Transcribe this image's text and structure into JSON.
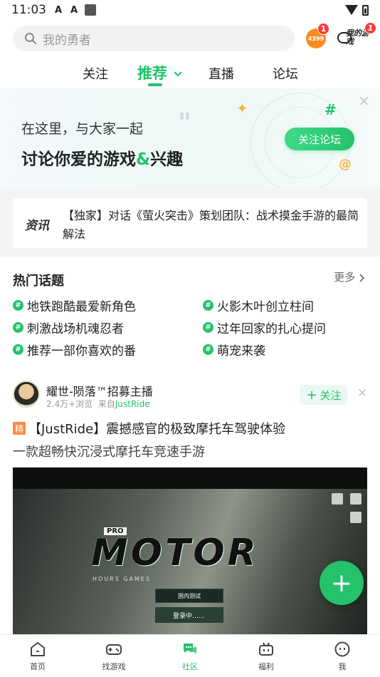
{
  "status": {
    "time": "11:03"
  },
  "search": {
    "placeholder": "我的勇者",
    "app_badge": "1",
    "my_games_badge": "1",
    "app_icon_text": "4399",
    "my_games_label": "我的游戏"
  },
  "tabs": [
    {
      "label": "关注"
    },
    {
      "label": "推荐",
      "active": true
    },
    {
      "label": "直播"
    },
    {
      "label": "论坛"
    }
  ],
  "banner": {
    "line1": "在这里，与大家一起",
    "line2_a": "讨论你爱的游戏",
    "line2_amp": "&",
    "line2_b": "兴趣",
    "button": "关注论坛"
  },
  "news": {
    "tag": "资讯",
    "text": "【独家】对话《萤火突击》策划团队：战术摸金手游的最简解法"
  },
  "hot_topics": {
    "title": "热门话题",
    "more": "更多",
    "items": [
      "地铁跑酷最爱新角色",
      "火影木叶创立柱间",
      "刺激战场机魂忍者",
      "过年回家的扎心提问",
      "推荐一部你喜欢的番",
      "萌宠来袭"
    ]
  },
  "post": {
    "user": "耀世-陨落™招募主播",
    "views": "2.4万+浏览",
    "source_prefix": "来自",
    "source": "JustRide",
    "follow": "关注",
    "tag": "精",
    "title": "【JustRide】震撼感官的极致摩托车驾驶体验",
    "subtitle": "一款超畅快沉浸式摩托车竞速手游",
    "video": {
      "logo": "MOTOR",
      "pro": "PRO",
      "logo_sub": "HOURS GAMES",
      "box1": "国内测试",
      "box2": "登录中……"
    }
  },
  "nav": [
    {
      "label": "首页",
      "icon": "home-icon"
    },
    {
      "label": "找游戏",
      "icon": "gamepad-icon"
    },
    {
      "label": "社区",
      "icon": "community-icon",
      "active": true
    },
    {
      "label": "福利",
      "icon": "gift-icon"
    },
    {
      "label": "我",
      "icon": "profile-icon"
    }
  ],
  "colors": {
    "accent": "#23c26b",
    "badge": "#ff3b3b",
    "tag": "#ff8a3d"
  }
}
